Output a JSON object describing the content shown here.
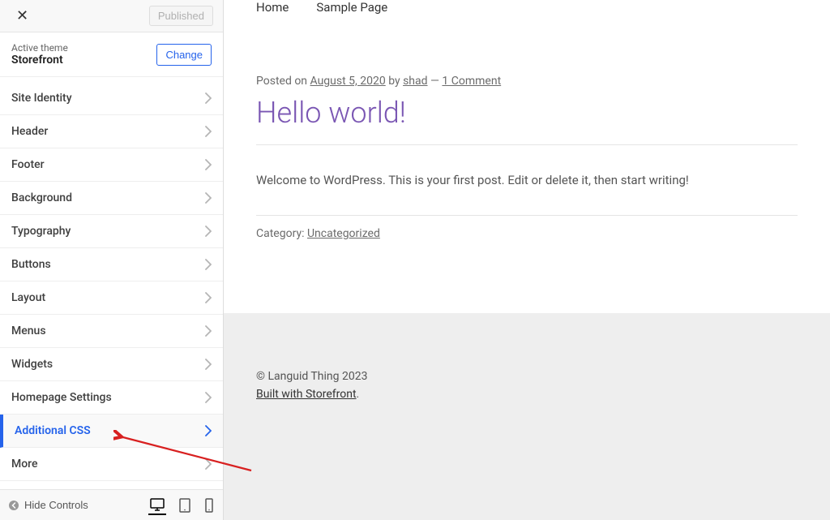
{
  "sidebar": {
    "top": {
      "published_label": "Published"
    },
    "theme": {
      "label": "Active theme",
      "name": "Storefront",
      "change_label": "Change"
    },
    "sections": [
      {
        "label": "Site Identity",
        "active": false
      },
      {
        "label": "Header",
        "active": false
      },
      {
        "label": "Footer",
        "active": false
      },
      {
        "label": "Background",
        "active": false
      },
      {
        "label": "Typography",
        "active": false
      },
      {
        "label": "Buttons",
        "active": false
      },
      {
        "label": "Layout",
        "active": false
      },
      {
        "label": "Menus",
        "active": false
      },
      {
        "label": "Widgets",
        "active": false
      },
      {
        "label": "Homepage Settings",
        "active": false
      },
      {
        "label": "Additional CSS",
        "active": true
      },
      {
        "label": "More",
        "active": false
      }
    ],
    "footer": {
      "hide_controls_label": "Hide Controls"
    }
  },
  "preview": {
    "nav": {
      "home": "Home",
      "sample_page": "Sample Page"
    },
    "post": {
      "posted_on": "Posted on ",
      "date": "August 5, 2020",
      "by": " by ",
      "author": "shad",
      "dash": " — ",
      "comments": "1 Comment",
      "title": "Hello world!",
      "body": "Welcome to WordPress. This is your first post. Edit or delete it, then start writing!",
      "category_label": "Category: ",
      "category_value": "Uncategorized"
    },
    "footer": {
      "copyright": "© Languid Thing 2023",
      "built_with": "Built with Storefront",
      "period": "."
    }
  }
}
